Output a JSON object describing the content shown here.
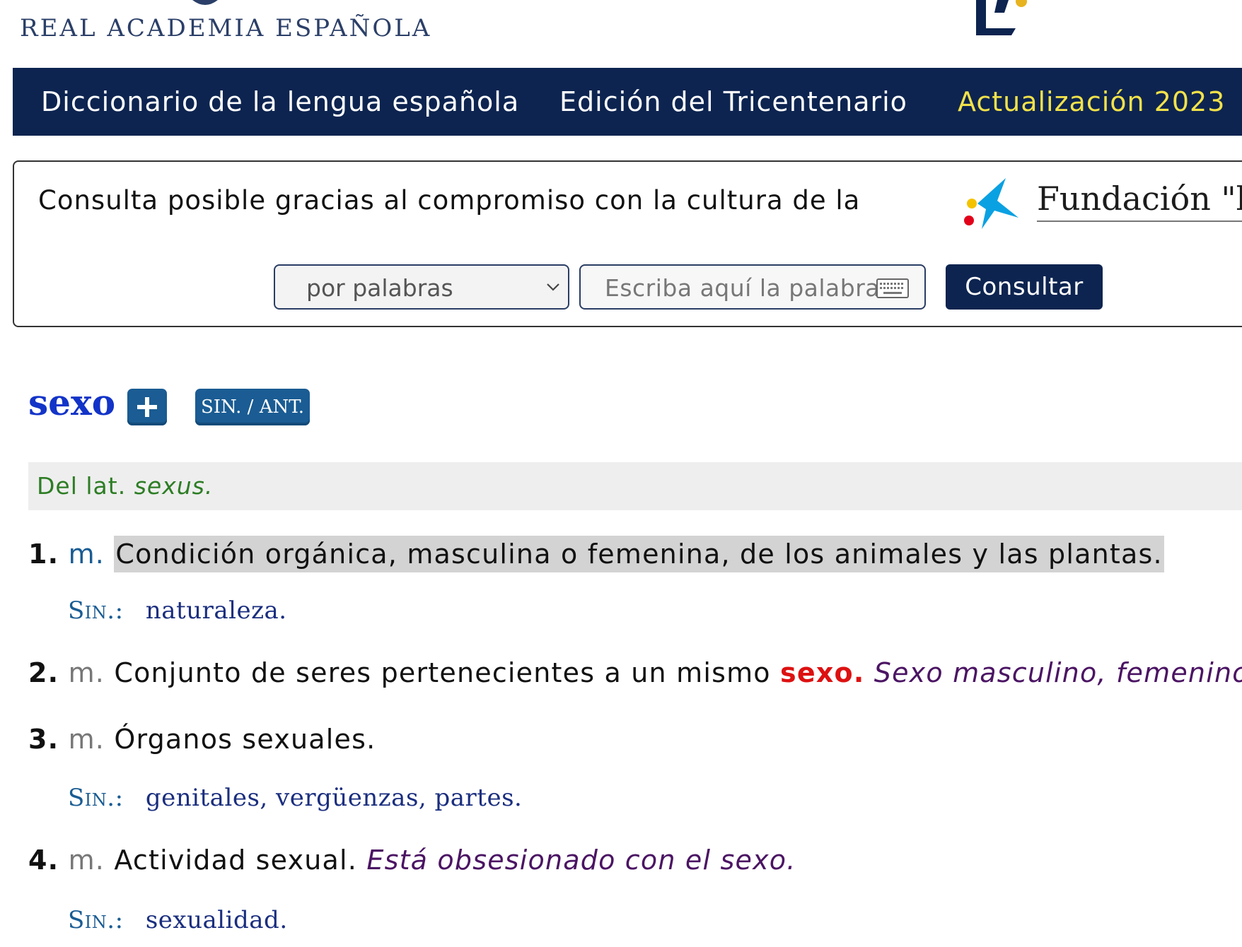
{
  "header": {
    "logo_text": "REAL ACADEMIA ESPAÑOLA"
  },
  "navbar": {
    "items": [
      {
        "label": "Diccionario de la lengua española"
      },
      {
        "label": "Edición del Tricentenario"
      },
      {
        "label": "Actualización 2023"
      }
    ]
  },
  "search": {
    "sponsor_text": "Consulta posible gracias al compromiso con la cultura de la",
    "sponsor_name": "Fundación \"la",
    "mode_value": "por palabras",
    "input_placeholder": "Escriba aquí la palabra",
    "submit_label": "Consultar"
  },
  "entry": {
    "headword": "sexo",
    "sin_ant_label": "SIN. / ANT.",
    "etymology_prefix": "Del lat.",
    "etymology_word": "sexus.",
    "senses": [
      {
        "num": "1.",
        "abbr": "m.",
        "definition": "Condición orgánica, masculina o femenina, de los animales y las plantas.",
        "syn_label": "Sin.:",
        "syn": "naturaleza."
      },
      {
        "num": "2.",
        "abbr": "m.",
        "definition": "Conjunto de seres pertenecientes a un mismo",
        "crossref": "sexo.",
        "example": "Sexo masculino, femenino."
      },
      {
        "num": "3.",
        "abbr": "m.",
        "definition": "Órganos sexuales.",
        "syn_label": "Sin.:",
        "syn": "genitales, vergüenzas, partes."
      },
      {
        "num": "4.",
        "abbr": "m.",
        "definition": "Actividad sexual.",
        "example": "Está obsesionado con el sexo.",
        "syn_label": "Sin.:",
        "syn": "sexualidad."
      }
    ]
  },
  "colors": {
    "navbar_bg": "#0d2450",
    "nav_highlight": "#f2e24a",
    "headword": "#1334c8",
    "button_blue": "#1a5c93",
    "etymology": "#2d7d24",
    "crossref": "#dd1111",
    "example": "#4b1463"
  },
  "icons": [
    "rae-crest-icon",
    "asale-logo-icon",
    "sponsor-star-logo",
    "chevron-down-icon",
    "keyboard-icon",
    "plus-icon"
  ]
}
